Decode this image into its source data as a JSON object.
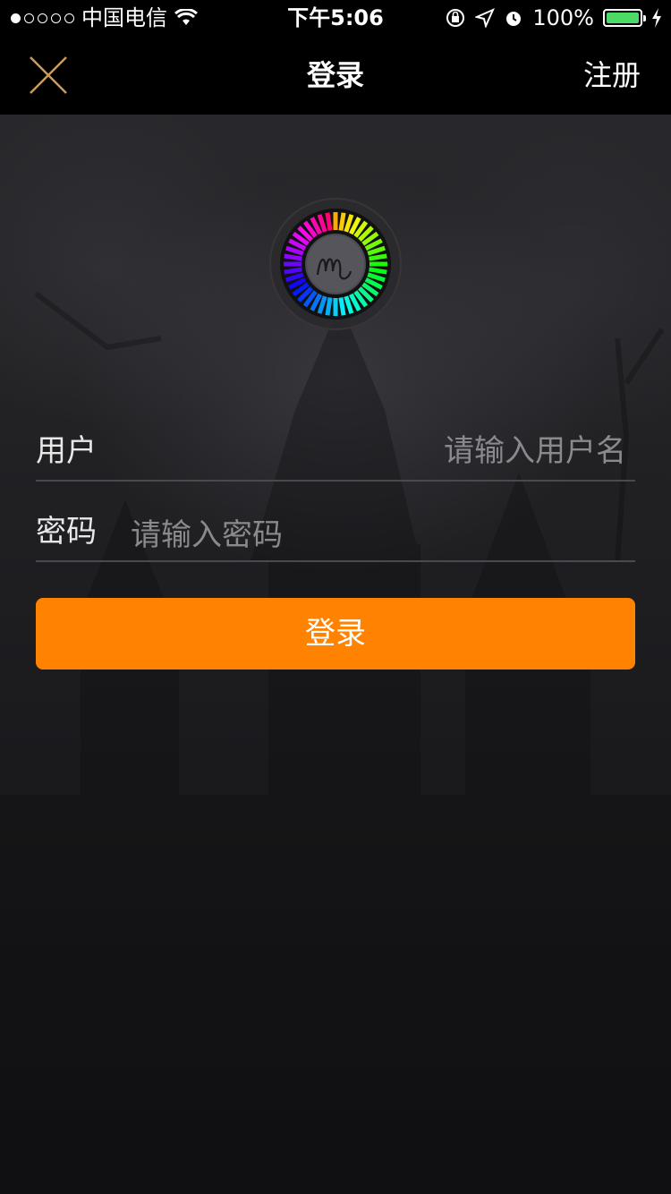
{
  "status_bar": {
    "carrier": "中国电信",
    "time": "下午5:06",
    "battery": "100%",
    "battery_color": "#4cd964"
  },
  "nav": {
    "title": "登录",
    "register_label": "注册",
    "close_icon": "close-icon",
    "close_color": "#c99a5b"
  },
  "form": {
    "username_label": "用户",
    "username_placeholder": "请输入用户名",
    "password_label": "密码",
    "password_placeholder": "请输入密码"
  },
  "login_button": {
    "label": "登录",
    "color": "#ff8200"
  }
}
